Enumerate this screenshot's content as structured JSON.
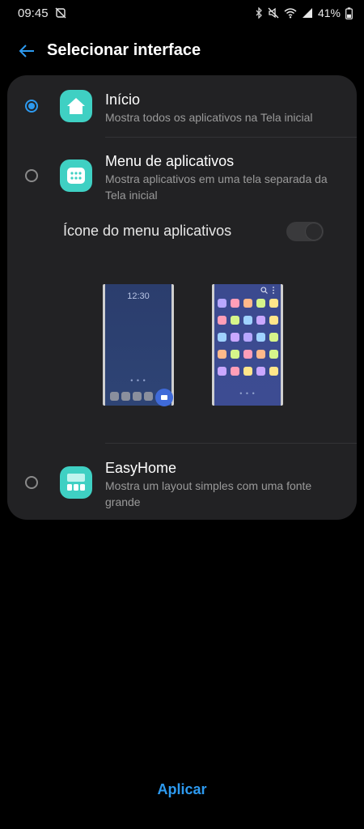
{
  "status_bar": {
    "time": "09:45",
    "battery_text": "41%",
    "icons": [
      "do-not-disturb-off-icon",
      "bluetooth-icon",
      "mute-icon",
      "wifi-icon",
      "signal-icon",
      "battery-icon"
    ]
  },
  "header": {
    "back_icon": "arrow-left-icon",
    "title": "Selecionar interface"
  },
  "options": [
    {
      "title": "Início",
      "description": "Mostra todos os aplicativos na Tela inicial",
      "selected": true,
      "icon": "home-icon"
    },
    {
      "title": "Menu de aplicativos",
      "description": "Mostra aplicativos em uma tela separada da Tela inicial",
      "selected": false,
      "icon": "app-grid-icon"
    },
    {
      "title": "EasyHome",
      "description": "Mostra um layout simples com uma fonte grande",
      "selected": false,
      "icon": "easyhome-icon"
    }
  ],
  "apps_menu_toggle": {
    "label": "Ícone do menu aplicativos",
    "enabled": false
  },
  "preview": {
    "home_time": "12:30"
  },
  "footer": {
    "apply_label": "Aplicar"
  },
  "colors": {
    "accent": "#2d9af0",
    "icon_bg": "#3fd0c3",
    "card_bg": "#222224"
  }
}
